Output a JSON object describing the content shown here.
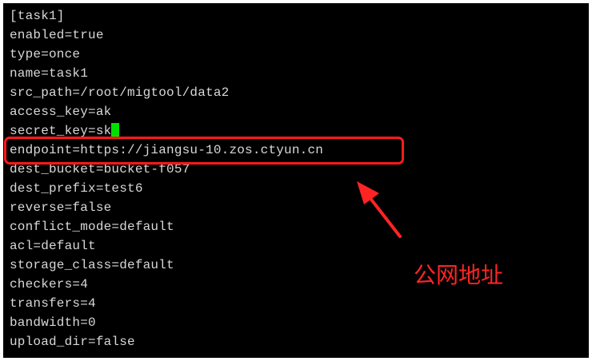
{
  "terminal": {
    "lines": [
      {
        "text": "[task1]"
      },
      {
        "text": "enabled=true"
      },
      {
        "text": "type=once"
      },
      {
        "text": "name=task1"
      },
      {
        "text": "src_path=/root/migtool/data2"
      },
      {
        "text": "access_key=ak"
      },
      {
        "text": "secret_key=sk"
      },
      {
        "text": "endpoint=https://jiangsu-10.zos.ctyun.cn"
      },
      {
        "text": "dest_bucket=bucket-f057"
      },
      {
        "text": "dest_prefix=test6"
      },
      {
        "text": "reverse=false"
      },
      {
        "text": "conflict_mode=default"
      },
      {
        "text": "acl=default"
      },
      {
        "text": "storage_class=default"
      },
      {
        "text": "checkers=4"
      },
      {
        "text": "transfers=4"
      },
      {
        "text": "bandwidth=0"
      },
      {
        "text": "upload_dir=false"
      }
    ],
    "colors": {
      "background": "#000000",
      "text": "#d8d8d8",
      "cursor": "#00e000"
    }
  },
  "annotation": {
    "label": "公网地址",
    "color": "#ff2424"
  }
}
